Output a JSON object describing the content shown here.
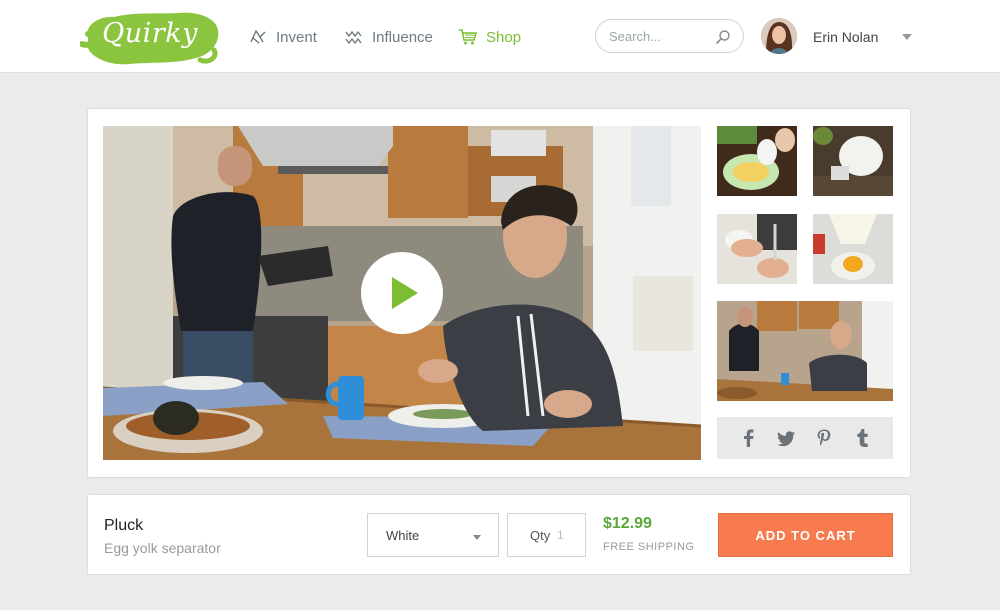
{
  "header": {
    "logo_text": "Quirky",
    "nav": [
      {
        "label": "Invent",
        "icon": "bulb-icon",
        "active": false
      },
      {
        "label": "Influence",
        "icon": "influence-icon",
        "active": false
      },
      {
        "label": "Shop",
        "icon": "cart-icon",
        "active": true
      }
    ],
    "search_placeholder": "Search...",
    "user_name": "Erin Nolan"
  },
  "media": {
    "video_label": "Product video",
    "share": [
      {
        "icon": "facebook-icon",
        "glyph": "f"
      },
      {
        "icon": "twitter-icon",
        "glyph": "t"
      },
      {
        "icon": "pinterest-icon",
        "glyph": "p"
      },
      {
        "icon": "tumblr-icon",
        "glyph": "t"
      }
    ]
  },
  "product": {
    "name": "Pluck",
    "description": "Egg yolk separator",
    "color_selected": "White",
    "qty_label": "Qty",
    "qty_value": "1",
    "price": "$12.99",
    "shipping": "FREE SHIPPING",
    "cart_label": "ADD TO CART"
  },
  "colors": {
    "brand_green": "#7cbd32",
    "price_green": "#5aa83a",
    "cart_orange": "#f87a4f"
  }
}
